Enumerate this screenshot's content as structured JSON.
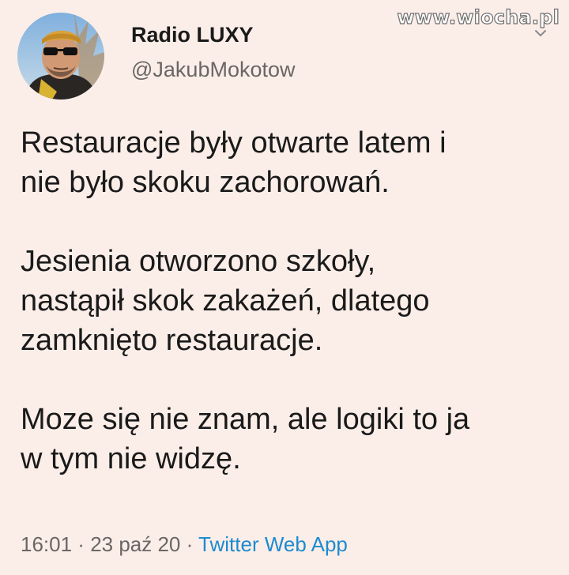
{
  "watermark": "www.wiocha.pl",
  "icons": {
    "menu": "chevron-down-icon",
    "avatar": "profile-photo"
  },
  "author": {
    "display_name": "Radio LUXY",
    "handle": "@JakubMokotow"
  },
  "tweet": {
    "paragraphs": [
      "Restauracje były otwarte latem i\nnie było skoku zachorowań.",
      "Jesienia otworzono szkoły,\nnastąpił skok zakażeń, dlatego\nzamknięto restauracje.",
      "Moze się nie znam, ale logiki to ja\nw tym nie widzę."
    ]
  },
  "meta": {
    "time": "16:01",
    "separator": " · ",
    "date": "23 paź 20",
    "source": "Twitter Web App"
  },
  "colors": {
    "background": "#fbeee9",
    "text": "#1a1a1a",
    "secondary": "#6a6664",
    "link": "#1d8bd0"
  }
}
